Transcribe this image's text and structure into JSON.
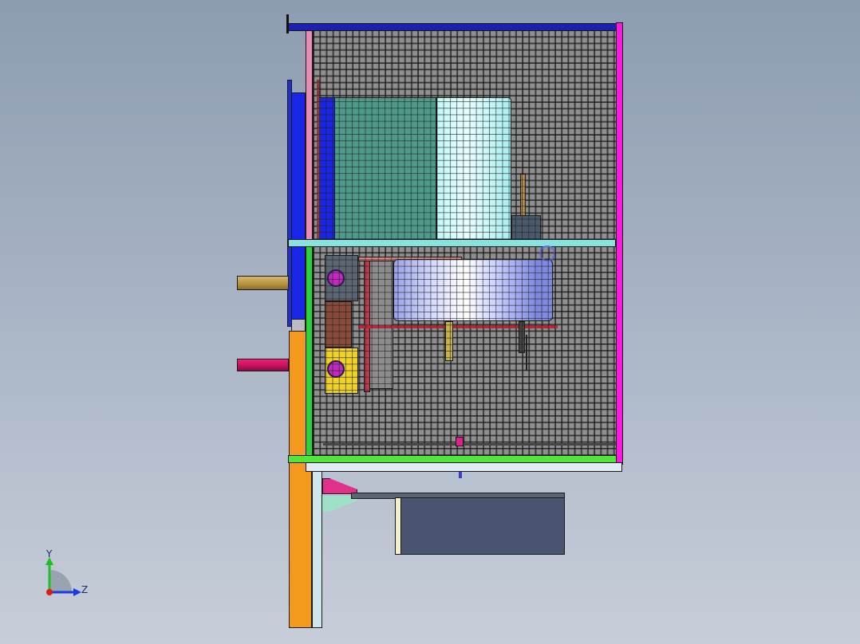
{
  "viewport": {
    "background_top": "#8d9cb0",
    "background_bottom": "#c7ced9"
  },
  "triad": {
    "y_label": "Y",
    "z_label": "Z",
    "y_color": "#1fbf2a",
    "z_color": "#1a3ae0",
    "origin_color": "#e01a1a"
  },
  "model": {
    "components": [
      "top-frame-rail",
      "right-frame-post",
      "mesh-guard-panel",
      "cyan-crossbar",
      "green-base-rail",
      "orange-column",
      "blue-mount-plate",
      "teal-panel",
      "cyan-tank",
      "blower-fan",
      "gearbox-upper",
      "gearbox-lower",
      "tan-shaft",
      "red-shaft",
      "control-box",
      "support-bracket"
    ]
  }
}
